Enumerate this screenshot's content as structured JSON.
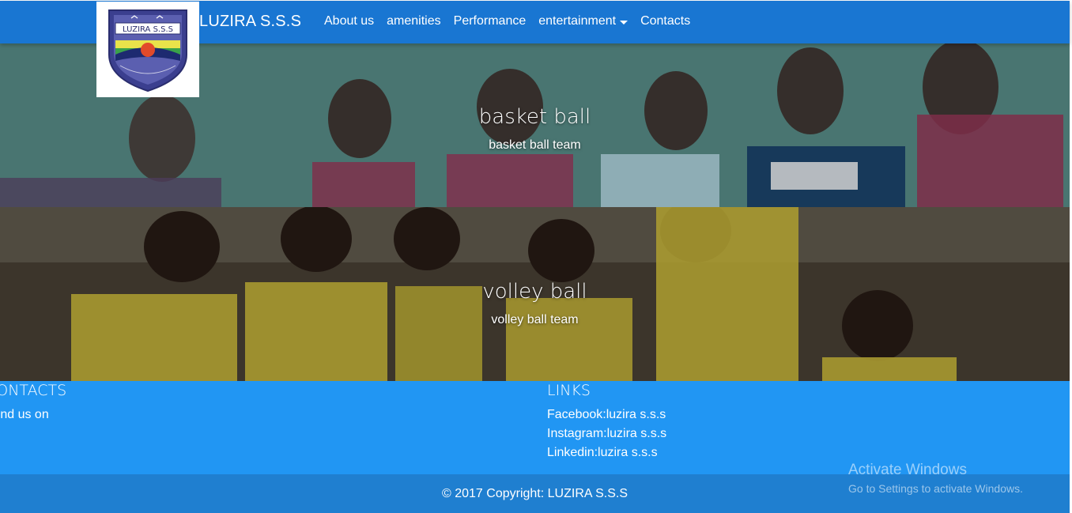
{
  "navbar": {
    "brand": "LUZIRA S.S.S",
    "links": [
      "About us",
      "amenities",
      "Performance",
      "entertainment",
      "Contacts"
    ],
    "logo_text": "LUZIRA S.S.S"
  },
  "slides": [
    {
      "title": "basket ball",
      "subtitle": "basket ball team"
    },
    {
      "title": "volley ball",
      "subtitle": "volley ball team"
    }
  ],
  "footer": {
    "contacts_title": "CONTACTS",
    "contacts_text": "Find us on",
    "links_title": "LINKS",
    "links": [
      "Facebook:luzira s.s.s",
      "Instagram:luzira s.s.s",
      "Linkedin:luzira s.s.s"
    ],
    "copyright_prefix": "© 2017 Copyright:",
    "copyright_link": "LUZIRA S.S.S"
  },
  "watermark": {
    "title": "Activate Windows",
    "subtitle": "Go to Settings to activate Windows."
  },
  "colors": {
    "navbar": "#1976d2",
    "footer": "#2196f3",
    "copyright_bar": "#1f7fd0"
  }
}
